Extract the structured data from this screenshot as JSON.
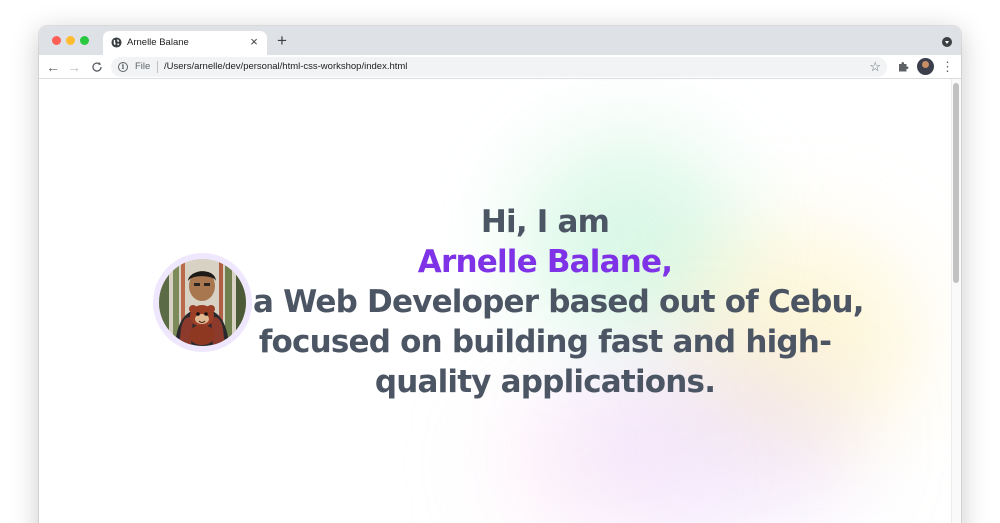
{
  "browser": {
    "tab_title": "Arnelle Balane",
    "tab_close": "×",
    "new_tab": "+",
    "back": "←",
    "forward": "→",
    "reload": "C",
    "scheme_label": "File",
    "url": "/Users/arnelle/dev/personal/html-css-workshop/index.html",
    "bookmark": "☆",
    "menu": "⋮"
  },
  "hero": {
    "greeting": "Hi, I am",
    "name": "Arnelle Balane,",
    "line3": "a Web Developer based out of Cebu,",
    "line4": "focused on building fast and high-",
    "line5": "quality applications."
  },
  "colors": {
    "heading": "#4b5563",
    "name_accent": "#7e34e6",
    "photo_ring": "#efe7fd"
  }
}
